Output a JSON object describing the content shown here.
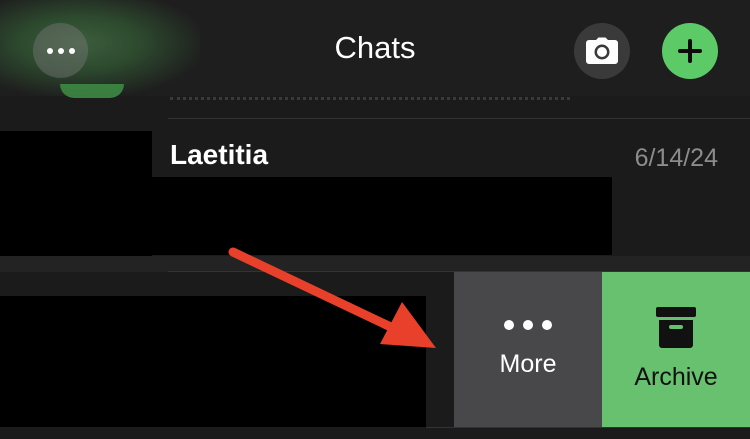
{
  "header": {
    "title": "Chats",
    "menu_icon": "more-horizontal-icon",
    "camera_icon": "camera-icon",
    "new_chat_icon": "plus-icon",
    "accent_color": "#5ccb67"
  },
  "chats": [
    {
      "name": "Laetitia",
      "date": "6/14/24"
    }
  ],
  "swipe_actions": {
    "more": {
      "label": "More",
      "icon": "more-dots-icon",
      "color": "#48484a"
    },
    "archive": {
      "label": "Archive",
      "icon": "archive-box-icon",
      "color": "#67c16f"
    }
  },
  "annotation": {
    "arrow_color": "#e8402a"
  }
}
